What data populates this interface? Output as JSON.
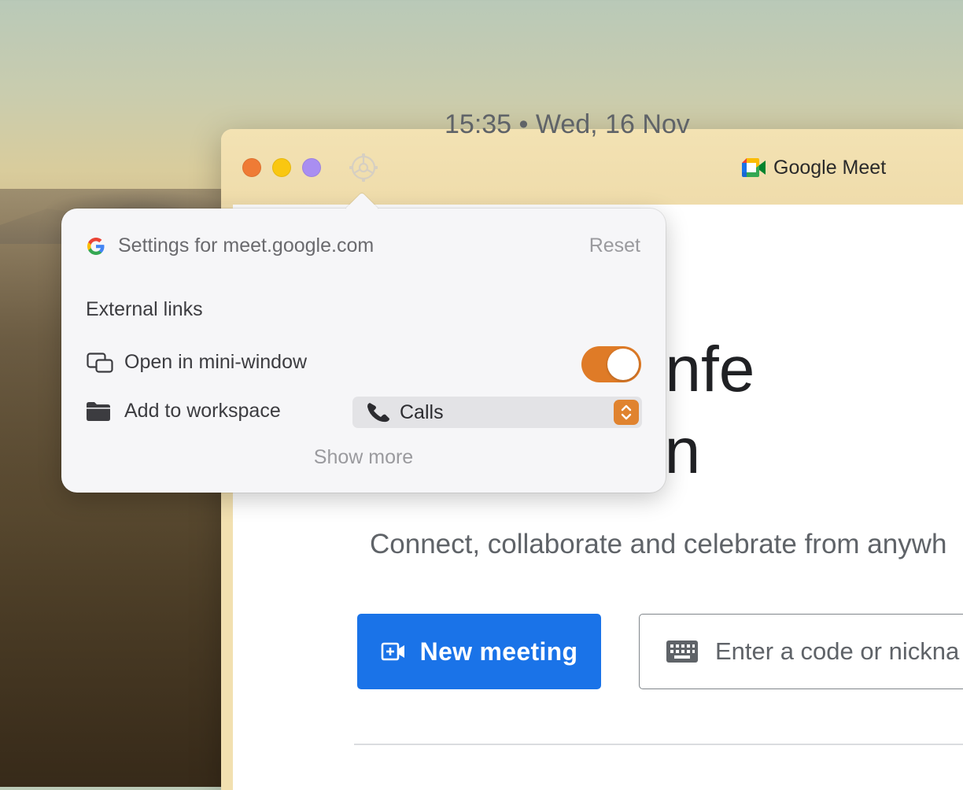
{
  "window": {
    "tab_title": "Google Meet"
  },
  "page": {
    "datetime": "15:35 • Wed, 16 Nov",
    "headline_line1": "video confe",
    "headline_line2": "for everyon",
    "subtitle": "Connect, collaborate and celebrate from anywh",
    "new_meeting_label": "New meeting",
    "code_placeholder": "Enter a code or nickna"
  },
  "popover": {
    "header": "Settings for meet.google.com",
    "reset_label": "Reset",
    "section_title": "External links",
    "options": [
      {
        "label": "Open in mini-window",
        "icon": "mini-window-icon",
        "toggle_on": true
      },
      {
        "label": "Add to workspace",
        "icon": "folder-icon",
        "select_value": "Calls",
        "select_icon": "phone-icon"
      }
    ],
    "show_more_label": "Show more"
  },
  "colors": {
    "accent_orange": "#df7b27",
    "meet_blue": "#1a73e8",
    "traffic_close": "#ef7b35",
    "traffic_min": "#f9c711",
    "traffic_max": "#a98ef1"
  }
}
